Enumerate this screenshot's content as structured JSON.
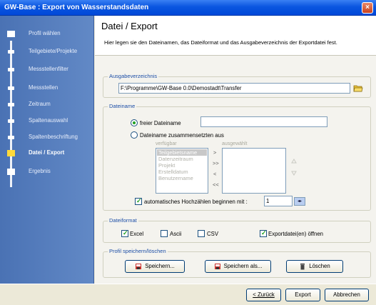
{
  "window": {
    "title": "GW-Base : Export von Wasserstandsdaten",
    "close_glyph": "×"
  },
  "sidebar": {
    "items": [
      {
        "label": "Profil wählen",
        "current": false
      },
      {
        "label": "Teilgebiete/Projekte",
        "current": false
      },
      {
        "label": "Messstellenfilter",
        "current": false
      },
      {
        "label": "Messstellen",
        "current": false
      },
      {
        "label": "Zeitraum",
        "current": false
      },
      {
        "label": "Spaltenauswahl",
        "current": false
      },
      {
        "label": "Spaltenbeschriftung",
        "current": false
      },
      {
        "label": "Datei / Export",
        "current": true
      },
      {
        "label": "Ergebnis",
        "current": false
      }
    ]
  },
  "header": {
    "title": "Datei / Export",
    "description": "Hier legen sie den Dateinamen, das Dateiformat und das Ausgabeverzeichnis der Exportdatei fest."
  },
  "output_dir": {
    "legend": "Ausgabeverzeichnis",
    "value": "F:\\Programme\\GW-Base 0.0\\Demostadt\\Transfer"
  },
  "filename": {
    "legend": "Dateiname",
    "free_label": "freier Dateiname",
    "free_value": "",
    "compose_label": "Dateiname zusammensetzten aus",
    "available_label": "verfügbar",
    "selected_label": "ausgewählt",
    "available_items": [
      "Teilgebietsname",
      "Datenzeitraum",
      "Projekt",
      "Erstelldatum",
      "Benutzername"
    ],
    "move_buttons": [
      ">",
      ">>",
      "<",
      "<<"
    ],
    "autoinc_label": "automatisches Hochzählen beginnen mit :",
    "autoinc_value": "1",
    "spin_glyph": "◂▸"
  },
  "fileformat": {
    "legend": "Dateiformat",
    "options": [
      {
        "label": "Excel",
        "checked": true
      },
      {
        "label": "Ascii",
        "checked": false
      },
      {
        "label": "CSV",
        "checked": false
      }
    ],
    "open_after_label": "Exportdatei(en) öffnen",
    "open_after_checked": true
  },
  "profile": {
    "legend": "Profil speichern/löschen",
    "save_label": "Speichern...",
    "save_as_label": "Speichern als...",
    "delete_label": "Löschen"
  },
  "footer": {
    "back_label": "< Zurück",
    "export_label": "Export",
    "cancel_label": "Abbrechen"
  }
}
